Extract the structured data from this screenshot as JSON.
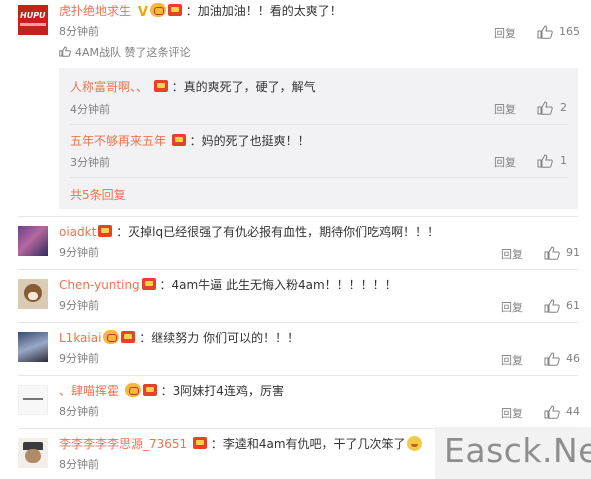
{
  "comments": [
    {
      "username": "虎扑绝地求生",
      "text": "：加油加油！！看的太爽了！",
      "time": "8分钟前",
      "reply_label": "回复",
      "likes": "165",
      "liked_by_text": "4AM战队 赞了这条评论",
      "avatar_label": "HUPU",
      "sub_replies": [
        {
          "username": "人称富哥啊、、",
          "text": "：真的爽死了，硬了，解气",
          "time": "4分钟前",
          "reply_label": "回复",
          "likes": "2"
        },
        {
          "username": "五年不够再来五年",
          "text": "：妈的死了也挺爽！！",
          "time": "3分钟前",
          "reply_label": "回复",
          "likes": "1"
        }
      ],
      "more_replies": "共5条回复"
    },
    {
      "username": "oiadkt",
      "text": "：灭掉lq已经很强了有仇必报有血性，期待你们吃鸡啊！！！",
      "time": "9分钟前",
      "reply_label": "回复",
      "likes": "91"
    },
    {
      "username": "Chen-yunting",
      "text": "：4am牛逼 此生无悔入粉4am！！！！！！",
      "time": "9分钟前",
      "reply_label": "回复",
      "likes": "61"
    },
    {
      "username": "L1kaiai",
      "text": "：继续努力 你们可以的！！！",
      "time": "9分钟前",
      "reply_label": "回复",
      "likes": "46"
    },
    {
      "username": "、肆喵挥霍",
      "text": "：3阿妹打4连鸡，厉害",
      "time": "8分钟前",
      "reply_label": "回复",
      "likes": "44"
    },
    {
      "username": "李李李李李思源_73651",
      "text": "：李逵和4am有仇吧，干了几次笨了",
      "time": "8分钟前"
    }
  ],
  "watermark": "Easck.Net",
  "colors": {
    "username": "#eb7350",
    "meta": "#808080",
    "subbox": "#f2f2f5"
  }
}
